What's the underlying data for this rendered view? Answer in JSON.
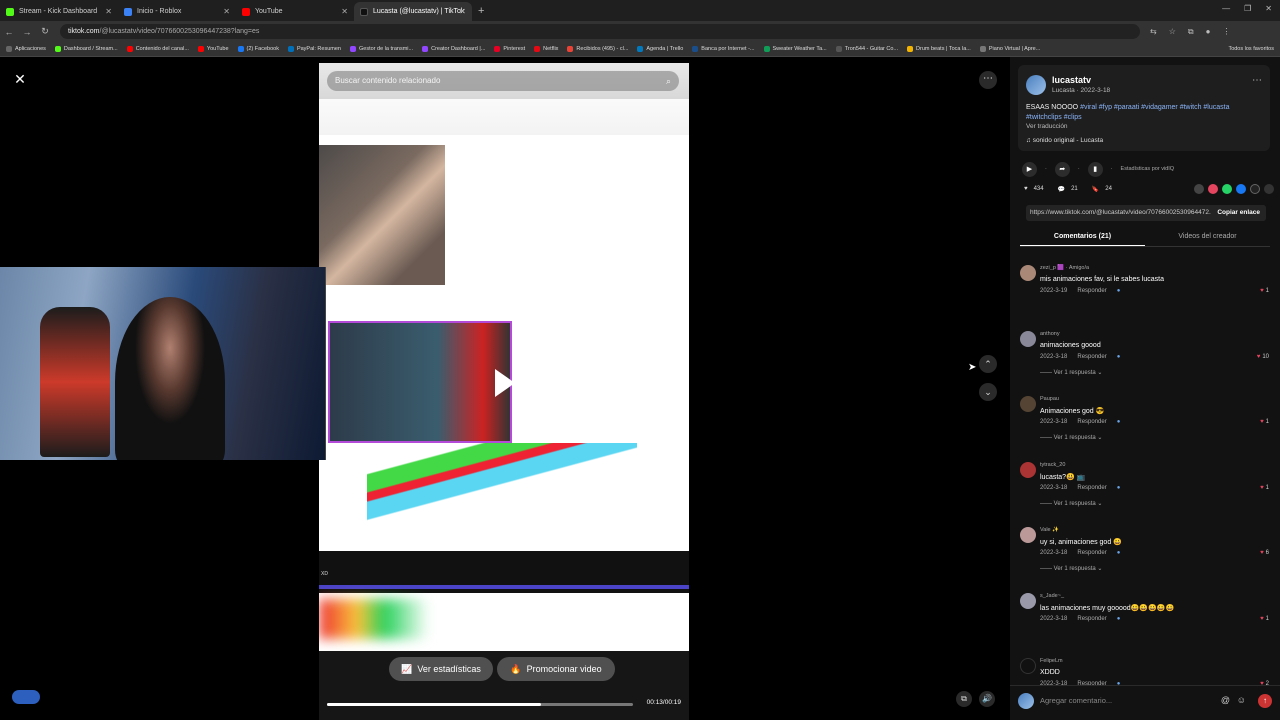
{
  "browser": {
    "tabs": [
      {
        "title": "Stream - Kick Dashboard",
        "color": "#53fc18"
      },
      {
        "title": "Inicio - Roblox",
        "color": "#3b82f6"
      },
      {
        "title": "YouTube",
        "color": "#ff0000"
      },
      {
        "title": "Lucasta (@lucastatv) | TikTok",
        "color": "#111111"
      }
    ],
    "url_host": "tiktok.com",
    "url_path": "/@lucastatv/video/7076600253096447238?lang=es",
    "bookmarks": [
      {
        "label": "Aplicaciones",
        "color": "#666"
      },
      {
        "label": "Dashboard / Stream...",
        "color": "#53fc18"
      },
      {
        "label": "Contenido del canal...",
        "color": "#ff0000"
      },
      {
        "label": "YouTube",
        "color": "#ff0000"
      },
      {
        "label": "(2) Facebook",
        "color": "#1877f2"
      },
      {
        "label": "PayPal: Resumen",
        "color": "#0070ba"
      },
      {
        "label": "Gestor de la transmi...",
        "color": "#9146ff"
      },
      {
        "label": "Creator Dashboard |...",
        "color": "#9146ff"
      },
      {
        "label": "Pinterest",
        "color": "#e60023"
      },
      {
        "label": "Netflix",
        "color": "#e50914"
      },
      {
        "label": "Recibidos (495) - cl...",
        "color": "#ea4335"
      },
      {
        "label": "Agenda | Trello",
        "color": "#0079bf"
      },
      {
        "label": "Banca por Internet -...",
        "color": "#1a4e8a"
      },
      {
        "label": "Sweater Weather Ta...",
        "color": "#0f9d58"
      },
      {
        "label": "Tron544 - Guitar Co...",
        "color": "#555"
      },
      {
        "label": "Drum beats | Toca la...",
        "color": "#f4b400"
      },
      {
        "label": "Piano Virtual | Apre...",
        "color": "#777"
      }
    ],
    "bookmarks_all": "Todos los favoritos"
  },
  "video": {
    "search_placeholder": "Buscar contenido relacionado",
    "filename": "ave.com_no_dire_nada-vddk8c36gfi81.mp4",
    "seek_label": "XD",
    "stats_label": "Ver estadísticas",
    "promote_label": "Promocionar video",
    "time": "00:13/00:19",
    "progress": 0.7
  },
  "sidebar": {
    "username": "lucastatv",
    "subline": "Lucasta · 2022-3-18",
    "description_prefix": "ESAAS NOOOO",
    "hashtags": "#viral #fyp #paraati #vidagamer #twitch #lucasta #twitchclips #clips",
    "translate": "Ver traducción",
    "sound": "sonido original - Lucasta",
    "stats_by": "Estadísticas por vidIQ",
    "likes": "434",
    "comments_count": "21",
    "saves": "24",
    "link": "https://www.tiktok.com/@lucastatv/video/70766002530964472...",
    "copy_link": "Copiar enlace",
    "tab_comments": "Comentarios (21)",
    "tab_creator": "Videos del creador",
    "comments": [
      {
        "user": "zezi_p 🟪 · Amigo/a",
        "text": "mis animaciones fav, si le sabes lucasta",
        "date": "2022-3-19",
        "reply": "Responder",
        "likes": "1",
        "replies": "",
        "color": "#a87"
      },
      {
        "user": "anthony",
        "text": "animaciones goood",
        "date": "2022-3-18",
        "reply": "Responder",
        "likes": "10",
        "replies": "Ver 1 respuesta",
        "color": "#889"
      },
      {
        "user": "Paupau",
        "text": "Animaciones god 😎",
        "date": "2022-3-18",
        "reply": "Responder",
        "likes": "1",
        "replies": "Ver 1 respuesta",
        "color": "#543"
      },
      {
        "user": "tytrack_20",
        "text": "lucasta?😃 📺",
        "date": "2022-3-18",
        "reply": "Responder",
        "likes": "1",
        "replies": "Ver 1 respuesta",
        "color": "#a33"
      },
      {
        "user": "Vale ✨",
        "text": "uy si, animaciones god 😀",
        "date": "2022-3-18",
        "reply": "Responder",
        "likes": "6",
        "replies": "Ver 1 respuesta",
        "color": "#b99"
      },
      {
        "user": "s_Jade~_",
        "text": "las animaciones muy gooood😀😀😀😀😀",
        "date": "2022-3-18",
        "reply": "Responder",
        "likes": "1",
        "replies": "",
        "color": "#99a"
      },
      {
        "user": "FelipeLm",
        "text": "XDDD",
        "date": "2022-3-18",
        "reply": "Responder",
        "likes": "2",
        "replies": "",
        "color": "#111"
      }
    ],
    "comment_placeholder": "Agregar comentario..."
  }
}
